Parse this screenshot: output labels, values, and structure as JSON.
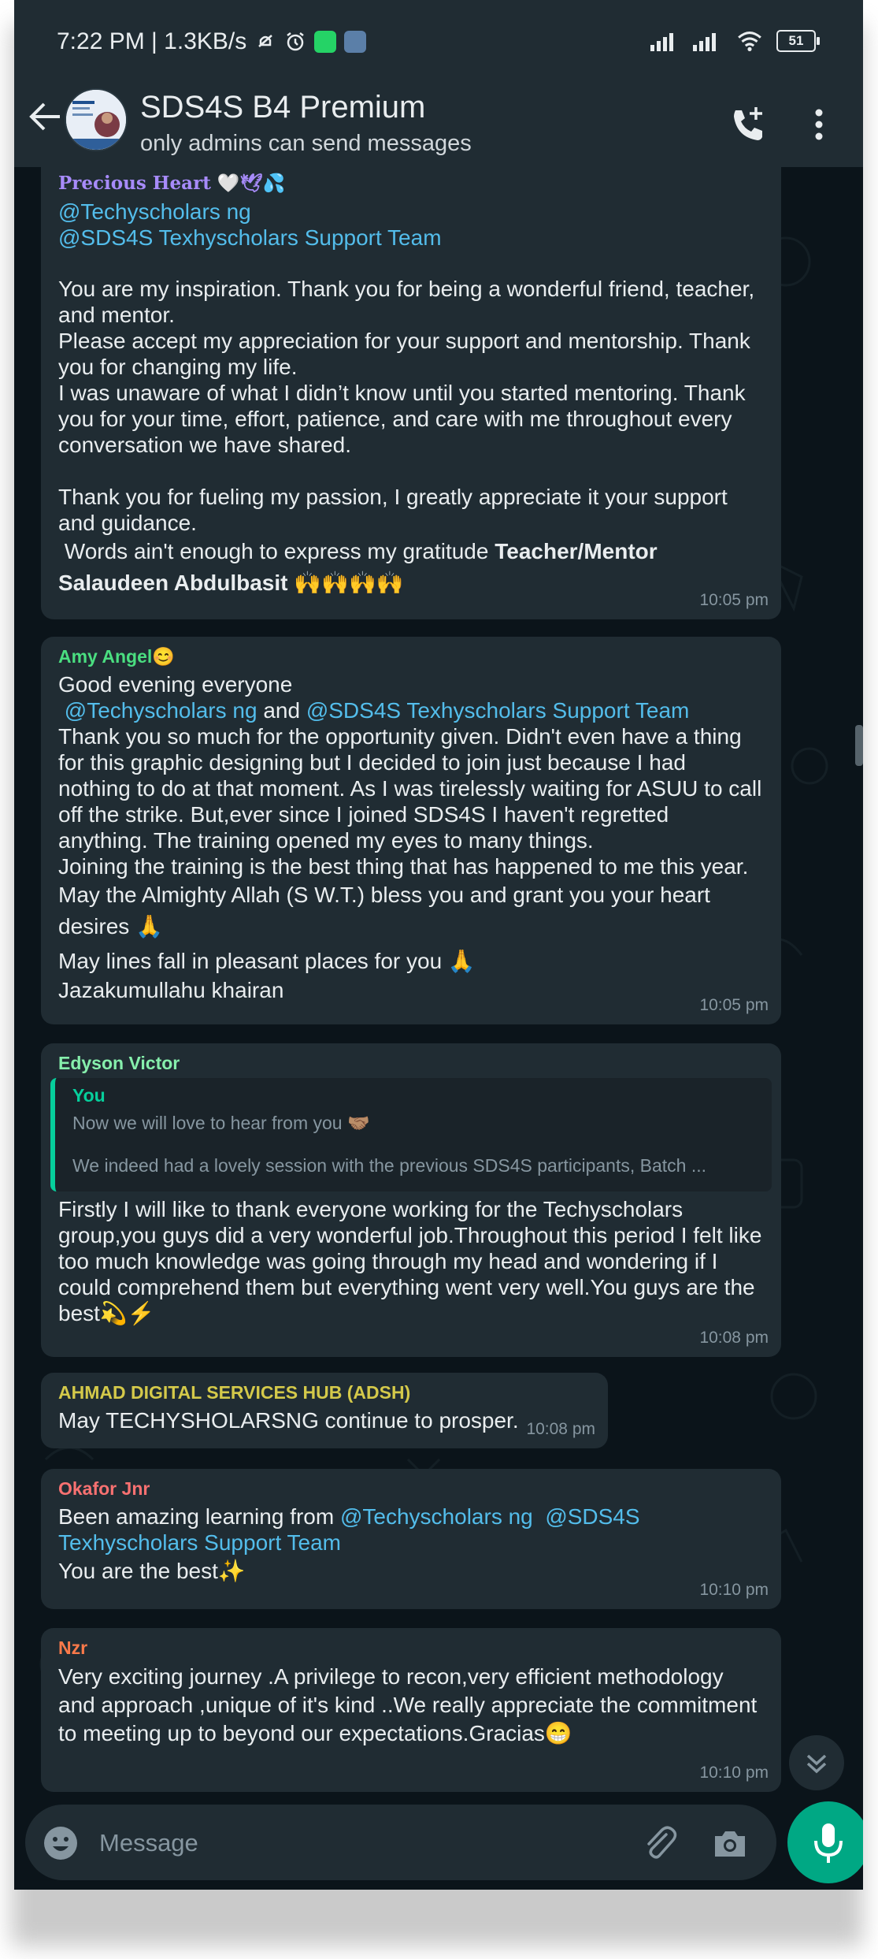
{
  "status_bar": {
    "time_speed": "7:22 PM | 1.3KB/s",
    "battery": "51"
  },
  "header": {
    "title": "SDS4S B4 Premium",
    "subtitle": "only admins can send messages"
  },
  "messages": [
    {
      "sender": "Precious Heart 🤍🕊💦",
      "sender_color": "#a78bfa",
      "mentions": [
        "@Techyscholars ng",
        "@SDS4S Texhyscholars Support Team"
      ],
      "para1": "You are my inspiration. Thank you for being a wonderful friend, teacher, and mentor.",
      "para2": "Please accept my appreciation for your support and mentorship. Thank you for changing my life.",
      "para3": "I was unaware of what I didn’t know until you started mentoring. Thank you for your time, effort, patience, and care with me throughout every conversation we have shared.",
      "para4": "Thank you for fueling my passion, I greatly appreciate it your support and guidance.",
      "para5": " Words ain't enough to express my gratitude ",
      "bold": "Teacher/Mentor Salaudeen Abdulbasit",
      "emoji": "🙌🙌🙌🙌",
      "time": "10:05 pm"
    },
    {
      "sender": "Amy Angel😊",
      "sender_color": "#4ade80",
      "line1": "Good evening everyone",
      "mention1": "@Techyscholars ng",
      "and": " and ",
      "mention2": "@SDS4S Texhyscholars Support Team",
      "para1": "Thank you so much for the opportunity given. Didn't even have a thing for this graphic designing but I decided to join just because I had nothing to do at that moment. As I was tirelessly waiting for ASUU to call off the strike. But,ever since I joined SDS4S I haven't regretted anything. The training opened my eyes to many things.",
      "para2": "Joining the training is the best thing that has happened to me this year.",
      "para3": "May the Almighty Allah (S W.T.) bless you and grant you your heart desires 🙏",
      "para4": "May lines fall in pleasant places for you 🙏",
      "para5": "Jazakumullahu khairan",
      "time": "10:05 pm"
    },
    {
      "sender": "Edyson Victor",
      "sender_color": "#86efac",
      "quote_name": "You",
      "quote_line1": "Now we will love to hear from you 🤝🏽",
      "quote_line2": "We indeed had a lovely session with the previous SDS4S participants, Batch ...",
      "body": "Firstly I will like to thank everyone working for the Techyscholars group,you guys did a very wonderful job.Throughout this period I felt like too much knowledge was going through my head and wondering if I could comprehend them but everything went very well.You guys are the best💫⚡",
      "time": "10:08 pm"
    },
    {
      "sender": "AHMAD DIGITAL SERVICES HUB (ADSH)",
      "sender_color": "#d4c94a",
      "body": "May TECHYSHOLARSNG continue to prosper.",
      "time": "10:08 pm"
    },
    {
      "sender": "Okafor Jnr",
      "sender_color": "#f87171",
      "prefix": "Been amazing learning from ",
      "mention1": "@Techyscholars ng",
      "mention2": "@SDS4S Texhyscholars Support Team",
      "line2": "You are the best✨",
      "time": "10:10 pm"
    },
    {
      "sender": "Nzr",
      "sender_color": "#fb7a4a",
      "body": "Very exciting journey .A privilege to recon,very efficient methodology and approach ,unique of it's kind ..We really appreciate the commitment to meeting up to beyond our expectations.Gracias😁",
      "time": "10:10 pm"
    }
  ],
  "composer": {
    "placeholder": "Message"
  },
  "icons": [
    "back-arrow-icon",
    "group-avatar",
    "add-call-icon",
    "more-menu-icon",
    "scroll-down-icon",
    "emoji-icon",
    "attach-icon",
    "camera-icon",
    "mic-icon"
  ]
}
